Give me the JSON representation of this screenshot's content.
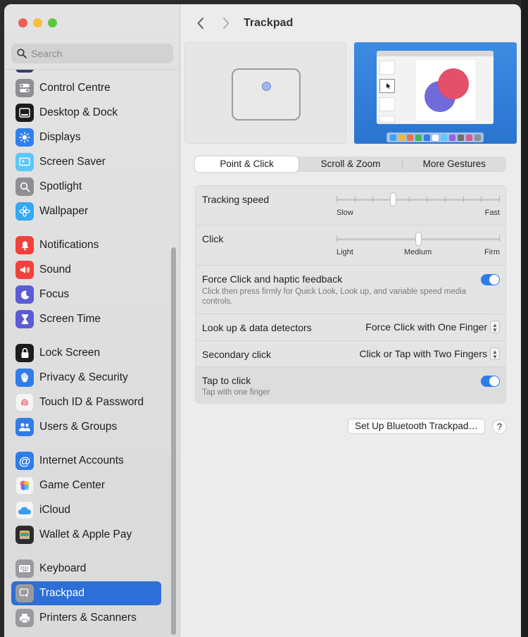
{
  "window": {
    "title": "Trackpad"
  },
  "traffic_lights": {
    "close": "#ee5f58",
    "minimize": "#f8bd3b",
    "maximize": "#5ec842"
  },
  "search": {
    "placeholder": "Search"
  },
  "sidebar": {
    "items": [
      {
        "label": "Control Centre",
        "icon": "toggle-switches-icon",
        "color": "#8e8e93"
      },
      {
        "label": "Desktop & Dock",
        "icon": "dock-icon",
        "color": "#1c1c1e"
      },
      {
        "label": "Displays",
        "icon": "sun-icon",
        "color": "#2f80ed"
      },
      {
        "label": "Screen Saver",
        "icon": "screen-saver-icon",
        "color": "#5ac8fa"
      },
      {
        "label": "Spotlight",
        "icon": "magnifier-icon",
        "color": "#8e8e93"
      },
      {
        "label": "Wallpaper",
        "icon": "flower-icon",
        "color": "#35a7f5"
      },
      {
        "label": "Notifications",
        "icon": "bell-icon",
        "color": "#f2413d"
      },
      {
        "label": "Sound",
        "icon": "speaker-icon",
        "color": "#f2413d"
      },
      {
        "label": "Focus",
        "icon": "moon-icon",
        "color": "#5b5bd6"
      },
      {
        "label": "Screen Time",
        "icon": "hourglass-icon",
        "color": "#5b5bd6"
      },
      {
        "label": "Lock Screen",
        "icon": "lock-icon",
        "color": "#1c1c1e"
      },
      {
        "label": "Privacy & Security",
        "icon": "hand-icon",
        "color": "#2f7ce8"
      },
      {
        "label": "Touch ID & Password",
        "icon": "fingerprint-icon",
        "color": "#f4f4f4"
      },
      {
        "label": "Users & Groups",
        "icon": "users-icon",
        "color": "#2f7ce8"
      },
      {
        "label": "Internet Accounts",
        "icon": "at-sign-icon",
        "color": "#2f7ce8"
      },
      {
        "label": "Game Center",
        "icon": "game-center-icon",
        "color": "#f4f4f4"
      },
      {
        "label": "iCloud",
        "icon": "cloud-icon",
        "color": "#f4f4f4"
      },
      {
        "label": "Wallet & Apple Pay",
        "icon": "wallet-icon",
        "color": "#2c2c2e"
      },
      {
        "label": "Keyboard",
        "icon": "keyboard-icon",
        "color": "#9b9b9f"
      },
      {
        "label": "Trackpad",
        "icon": "trackpad-icon",
        "color": "#9b9b9f"
      },
      {
        "label": "Printers & Scanners",
        "icon": "printer-icon",
        "color": "#9b9b9f"
      }
    ],
    "selected": "Trackpad"
  },
  "tabs": [
    {
      "label": "Point & Click",
      "active": true
    },
    {
      "label": "Scroll & Zoom",
      "active": false
    },
    {
      "label": "More Gestures",
      "active": false
    }
  ],
  "settings": {
    "tracking_speed": {
      "label": "Tracking speed",
      "min_label": "Slow",
      "max_label": "Fast",
      "value": 0.34
    },
    "click": {
      "label": "Click",
      "min_label": "Light",
      "mid_label": "Medium",
      "max_label": "Firm",
      "value": 0.5
    },
    "force_click": {
      "label": "Force Click and haptic feedback",
      "description": "Click then press firmly for Quick Look, Look up, and variable speed media controls.",
      "enabled": true
    },
    "look_up": {
      "label": "Look up & data detectors",
      "value": "Force Click with One Finger"
    },
    "secondary_click": {
      "label": "Secondary click",
      "value": "Click or Tap with Two Fingers"
    },
    "tap_to_click": {
      "label": "Tap to click",
      "description": "Tap with one finger",
      "enabled": true
    }
  },
  "buttons": {
    "bluetooth_setup": "Set Up Bluetooth Trackpad…",
    "help": "?"
  },
  "accent_color": "#2f7ce8"
}
